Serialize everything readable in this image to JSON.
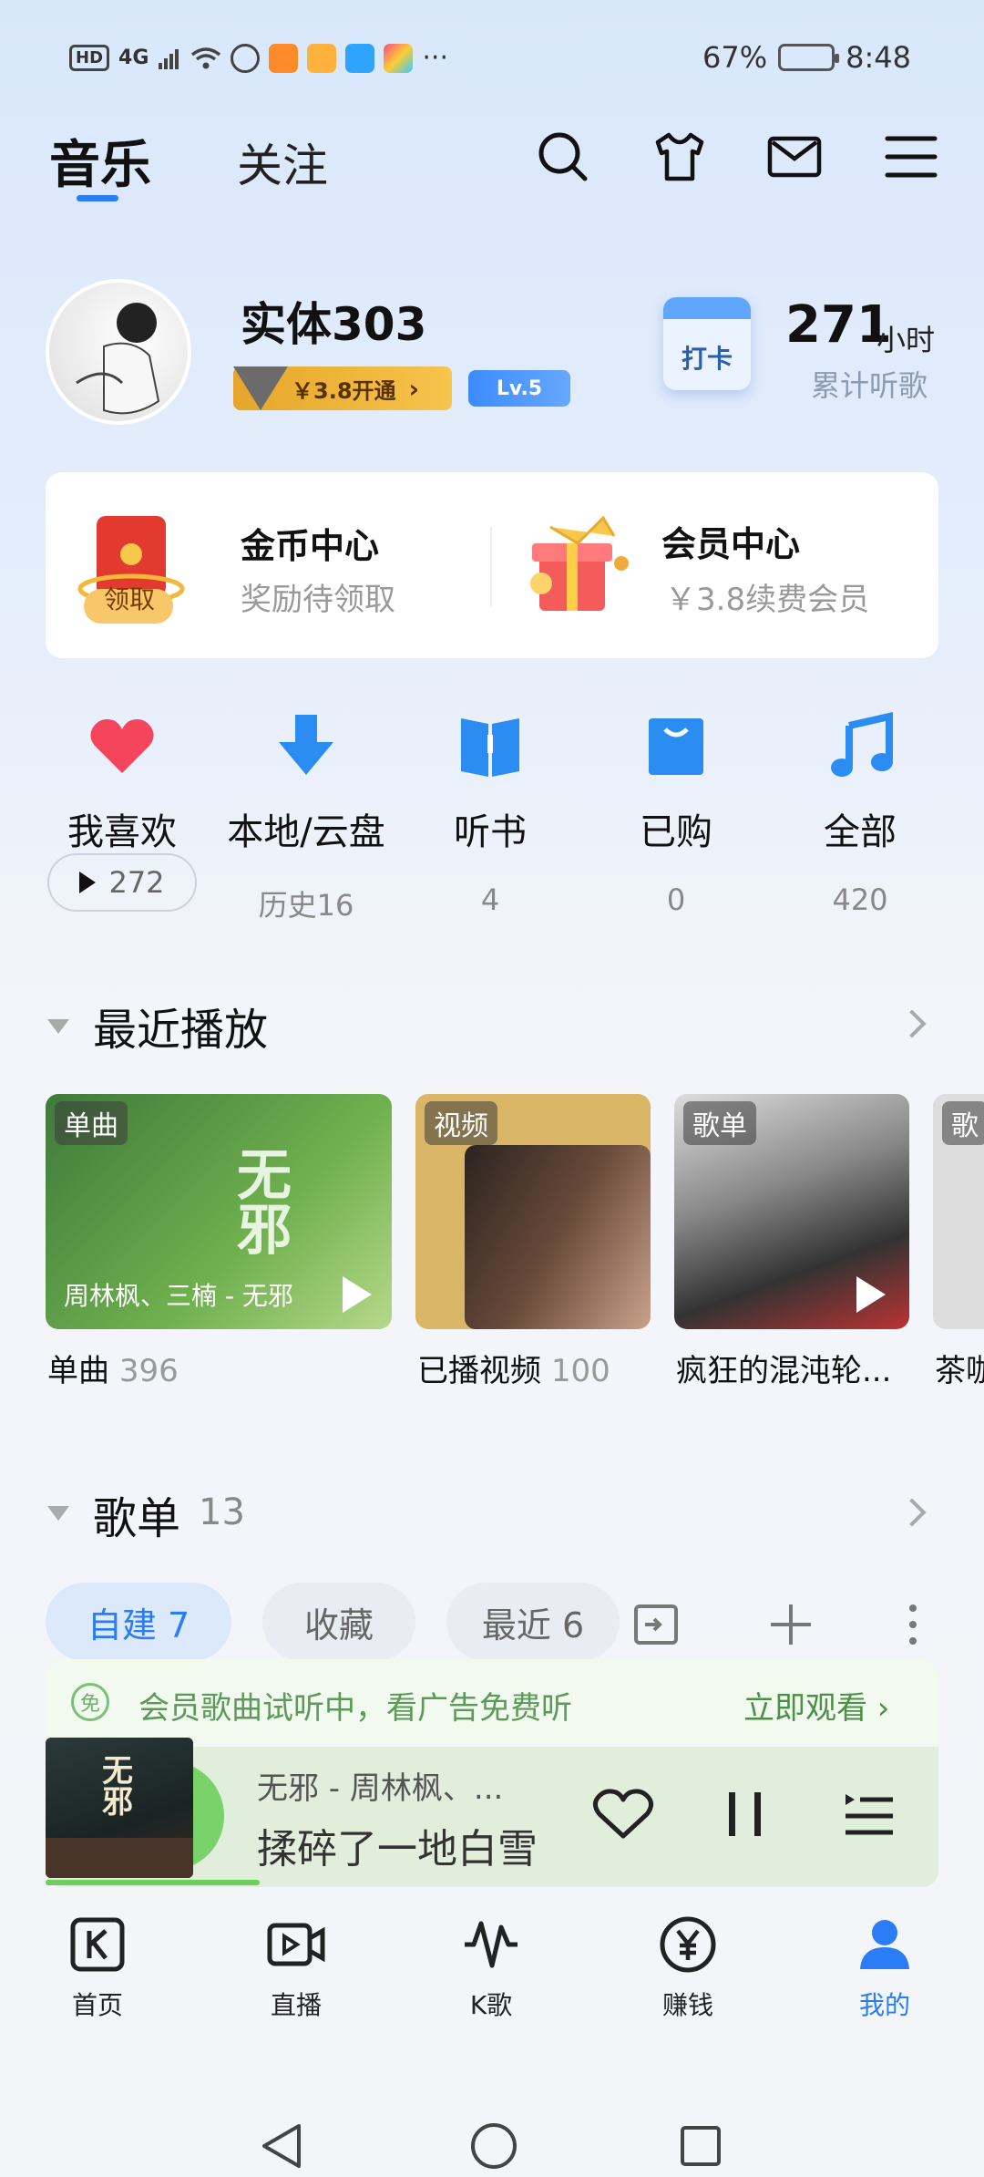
{
  "status_bar": {
    "network": "HD",
    "signal": "4G",
    "more": "···",
    "battery_percent": "67%",
    "time": "8:48"
  },
  "header": {
    "tab_music": "音乐",
    "tab_follow": "关注",
    "icons": [
      "search-icon",
      "tshirt-icon",
      "mail-icon",
      "menu-icon"
    ]
  },
  "profile": {
    "username": "实体303",
    "vip_badge": "￥3.8开通",
    "level": "Lv.5",
    "checkin_label": "打卡",
    "hours_value": "271",
    "hours_unit": "小时",
    "hours_label": "累计听歌"
  },
  "cards": {
    "coin_title": "金币中心",
    "coin_sub": "奖励待领取",
    "coin_badge": "领取",
    "vip_title": "会员中心",
    "vip_sub": "￥3.8续费会员"
  },
  "shortcuts": [
    {
      "label": "我喜欢",
      "count": "272"
    },
    {
      "label": "本地/云盘",
      "count": "历史16"
    },
    {
      "label": "听书",
      "count": "4"
    },
    {
      "label": "已购",
      "count": "0"
    },
    {
      "label": "全部",
      "count": "420"
    }
  ],
  "recent": {
    "title": "最近播放",
    "items": [
      {
        "tag": "单曲",
        "overlay": "周林枫、三楠 - 无邪",
        "caption": "单曲",
        "count": "396"
      },
      {
        "tag": "视频",
        "caption": "已播视频",
        "count": "100"
      },
      {
        "tag": "歌单",
        "caption": "疯狂的混沌轮..."
      },
      {
        "tag": "歌",
        "caption": "茶咖"
      }
    ]
  },
  "playlists": {
    "title": "歌单",
    "count": "13",
    "tabs": [
      "自建 7",
      "收藏",
      "最近 6"
    ]
  },
  "ad_banner": {
    "badge": "免",
    "text": "会员歌曲试听中，看广告免费听",
    "link": "立即观看 ›"
  },
  "player": {
    "song": "无邪  -  周林枫、...",
    "lyric": "揉碎了一地白雪",
    "progress": 0.24
  },
  "bottom_nav": [
    {
      "label": "首页",
      "icon": "k-home-icon"
    },
    {
      "label": "直播",
      "icon": "live-icon"
    },
    {
      "label": "K歌",
      "icon": "karaoke-icon"
    },
    {
      "label": "赚钱",
      "icon": "yen-icon"
    },
    {
      "label": "我的",
      "icon": "profile-icon"
    }
  ],
  "colors": {
    "accent": "#2a7cf7",
    "green": "#5b9a59"
  }
}
